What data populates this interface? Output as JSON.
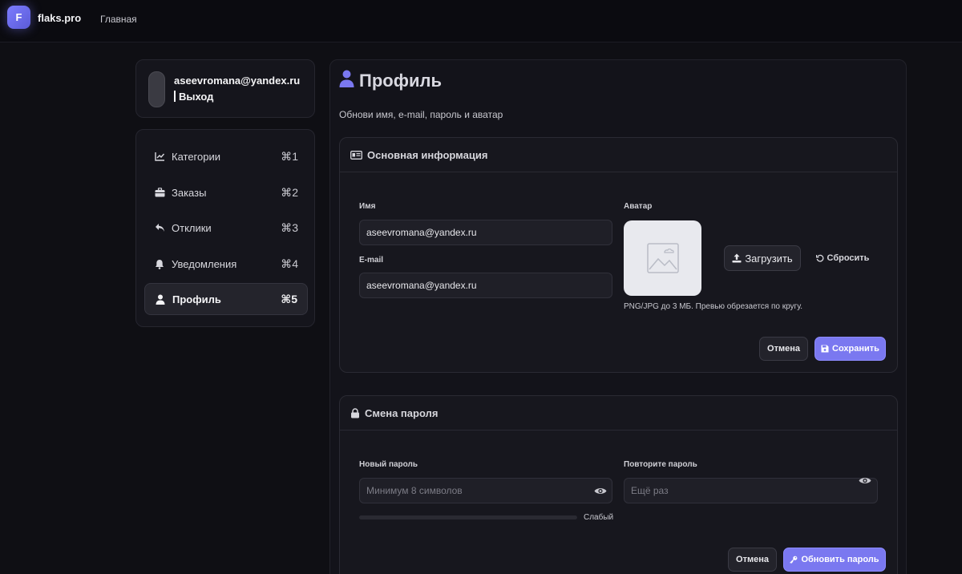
{
  "topbar": {
    "logo_letter": "F",
    "brand": "flaks.pro",
    "nav_home": "Главная"
  },
  "user": {
    "email": "aseevromana@yandex.ru",
    "logout": "Выход"
  },
  "sidebar": {
    "items": [
      {
        "label": "Категории",
        "shortcut": "⌘1",
        "icon": "chart-line-icon"
      },
      {
        "label": "Заказы",
        "shortcut": "⌘2",
        "icon": "briefcase-icon"
      },
      {
        "label": "Отклики",
        "shortcut": "⌘3",
        "icon": "reply-icon"
      },
      {
        "label": "Уведомления",
        "shortcut": "⌘4",
        "icon": "bell-icon"
      },
      {
        "label": "Профиль",
        "shortcut": "⌘5",
        "icon": "user-icon",
        "active": true
      }
    ]
  },
  "page": {
    "title": "Профиль",
    "subtitle": "Обнови имя, e-mail, пароль и аватар"
  },
  "basic_info": {
    "title": "Основная информация",
    "name_label": "Имя",
    "name_value": "aseevromana@yandex.ru",
    "email_label": "E-mail",
    "email_value": "aseevromana@yandex.ru",
    "avatar_label": "Аватар",
    "upload_label": "Загрузить",
    "reset_label": "Сбросить",
    "avatar_hint": "PNG/JPG до 3 МБ. Превью обрезается по кругу.",
    "cancel_label": "Отмена",
    "save_label": "Сохранить"
  },
  "password": {
    "title": "Смена пароля",
    "new_label": "Новый пароль",
    "new_placeholder": "Минимум 8 символов",
    "repeat_label": "Повторите пароль",
    "repeat_placeholder": "Ещё раз",
    "strength_label": "Слабый",
    "strength_value": 0,
    "cancel_label": "Отмена",
    "update_label": "Обновить пароль"
  },
  "colors": {
    "accent": "#7a78f0",
    "background": "#0f0f14",
    "panel": "#17171e"
  }
}
